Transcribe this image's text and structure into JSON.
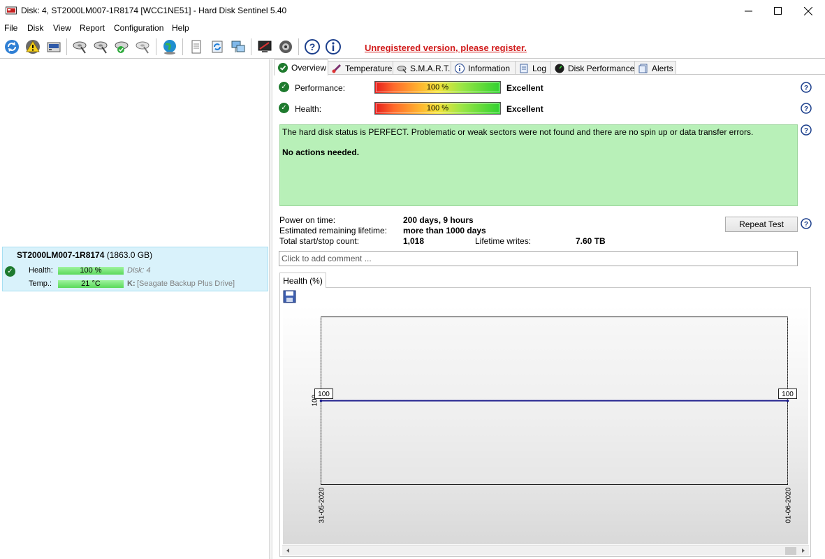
{
  "window": {
    "title": "Disk: 4, ST2000LM007-1R8174 [WCC1NE51]  -  Hard Disk Sentinel 5.40"
  },
  "menu": {
    "items": [
      {
        "label": "File"
      },
      {
        "label": "Disk"
      },
      {
        "label": "View"
      },
      {
        "label": "Report"
      },
      {
        "label": "Configuration"
      },
      {
        "label": "Help"
      }
    ]
  },
  "toolbar": {
    "register_text": "Unregistered version, please register."
  },
  "disk_card": {
    "name": "ST2000LM007-1R8174",
    "size": "(1863.0 GB)",
    "health_label": "Health:",
    "health_value": "100 %",
    "temp_label": "Temp.:",
    "temp_value": "21 °C",
    "disk_label": "Disk: 4",
    "drive_letter": "K:",
    "drive_name": "[Seagate Backup Plus Drive]"
  },
  "tabs": [
    {
      "label": "Overview"
    },
    {
      "label": "Temperature"
    },
    {
      "label": "S.M.A.R.T."
    },
    {
      "label": "Information"
    },
    {
      "label": "Log"
    },
    {
      "label": "Disk Performance"
    },
    {
      "label": "Alerts"
    }
  ],
  "overview": {
    "performance_label": "Performance:",
    "performance_percent": "100 %",
    "performance_rating": "Excellent",
    "health_label": "Health:",
    "health_percent": "100 %",
    "health_rating": "Excellent",
    "status_text": "The hard disk status is PERFECT. Problematic or weak sectors were not found and there are no spin up or data transfer errors.",
    "status_actions": "No actions needed.",
    "power_on_label": "Power on time:",
    "power_on_value": "200 days, 9 hours",
    "lifetime_label": "Estimated remaining lifetime:",
    "lifetime_value": "more than 1000 days",
    "startstop_label": "Total start/stop count:",
    "startstop_value": "1,018",
    "writes_label": "Lifetime writes:",
    "writes_value": "7.60 TB",
    "repeat_button": "Repeat Test",
    "comment_placeholder": "Click to add comment ..."
  },
  "chart_tab": {
    "label": "Health (%)"
  },
  "chart_data": {
    "type": "line",
    "title": "",
    "x": [
      "31-05-2020",
      "01-06-2020"
    ],
    "series": [
      {
        "values": [
          100,
          100
        ]
      }
    ],
    "data_labels": [
      "100",
      "100"
    ],
    "y_tick_label": "100",
    "line_color": "#1a1a8c",
    "grid": false
  },
  "colors": {
    "register_red": "#d11b1b",
    "status_green": "#b8f0b8",
    "selection_blue": "#d9f2fb",
    "check_green": "#1e7a2e"
  }
}
